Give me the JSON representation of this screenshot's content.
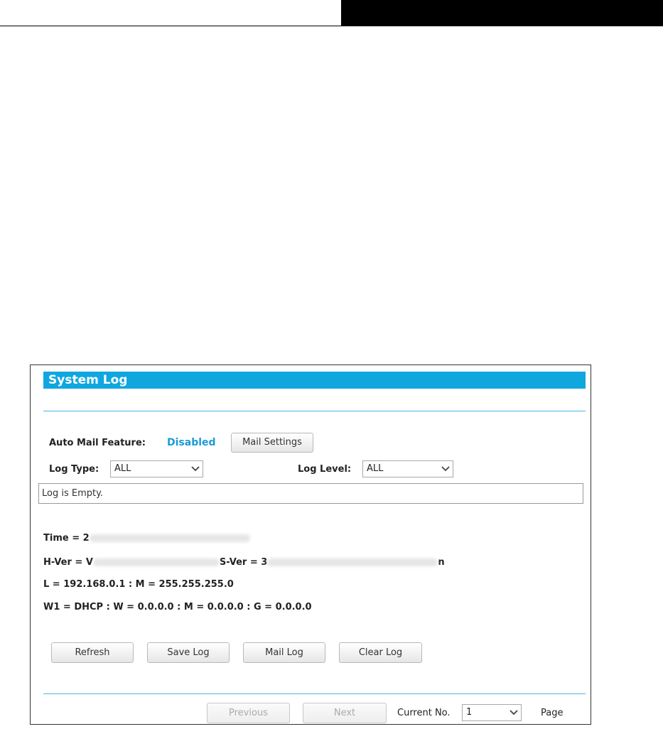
{
  "panel": {
    "title": "System Log",
    "auto_mail": {
      "label": "Auto Mail Feature:",
      "status": "Disabled",
      "settings_button": "Mail Settings"
    },
    "log_type": {
      "label": "Log Type:",
      "selected": "ALL"
    },
    "log_level": {
      "label": "Log Level:",
      "selected": "ALL"
    },
    "log_content": "Log is Empty.",
    "info": {
      "time": "Time = 2",
      "hver": "H-Ver = V",
      "sver": "S-Ver = 3",
      "sver_tail": "n",
      "lan": "L = 192.168.0.1 : M = 255.255.255.0",
      "wan": "W1 = DHCP : W = 0.0.0.0 : M = 0.0.0.0 : G = 0.0.0.0"
    },
    "buttons": {
      "refresh": "Refresh",
      "save_log": "Save Log",
      "mail_log": "Mail Log",
      "clear_log": "Clear Log"
    },
    "pager": {
      "previous": "Previous",
      "next": "Next",
      "current_label": "Current No.",
      "current_value": "1",
      "page_label": "Page"
    }
  },
  "colors": {
    "title_bar": "#10a7df",
    "status_text": "#1a9ad6",
    "rule": "#47b8e6"
  },
  "icons": [
    "chevron-down-icon"
  ]
}
